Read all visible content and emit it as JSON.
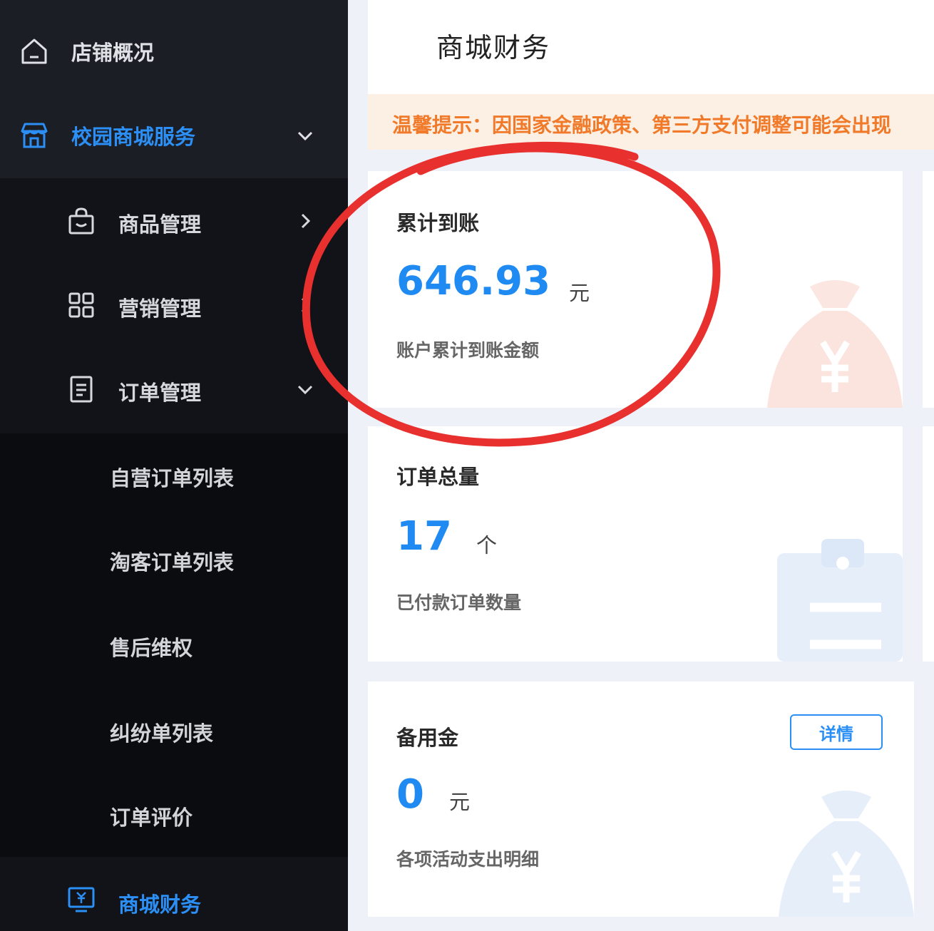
{
  "sidebar": {
    "top_items": [
      {
        "label": "店铺概况",
        "icon": "home-icon"
      },
      {
        "label": "校园商城服务",
        "icon": "store-icon",
        "active": true
      }
    ],
    "sub_items": [
      {
        "label": "商品管理",
        "icon": "bag-icon"
      },
      {
        "label": "营销管理",
        "icon": "grid-icon"
      },
      {
        "label": "订单管理",
        "icon": "document-icon"
      }
    ],
    "order_items": [
      {
        "label": "自营订单列表"
      },
      {
        "label": "淘客订单列表"
      },
      {
        "label": "售后维权"
      },
      {
        "label": "纠纷单列表"
      },
      {
        "label": "订单评价"
      }
    ],
    "finance_item": {
      "label": "商城财务",
      "icon": "finance-icon"
    }
  },
  "main": {
    "title": "商城财务",
    "notice": "温馨提示：因国家金融政策、第三方支付调整可能会出现",
    "cards": [
      {
        "title": "累计到账",
        "value": "646.93",
        "unit": "元",
        "desc": "账户累计到账金额",
        "icon": "money-bag-icon"
      },
      {
        "title": "订单总量",
        "value": "17",
        "unit": "个",
        "desc": "已付款订单数量",
        "icon": "clipboard-icon"
      },
      {
        "title": "备用金",
        "value": "0",
        "unit": "元",
        "desc": "各项活动支出明细",
        "button": "详情",
        "icon": "money-bag-icon"
      }
    ]
  },
  "colors": {
    "accent": "#2b8ff5",
    "value": "#1f8af2",
    "notice_text": "#f07a2a",
    "notice_bg": "#fcefe3",
    "annotation": "#e8302e",
    "sidebar_bg": "#1c1e25"
  }
}
